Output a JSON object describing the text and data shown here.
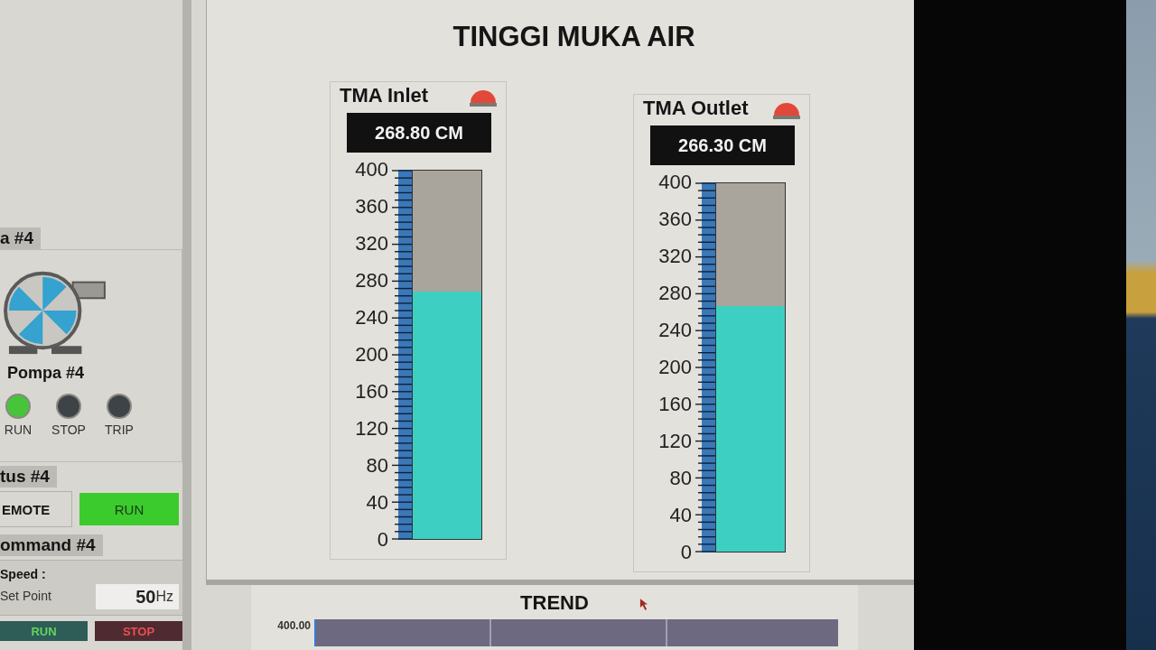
{
  "left_panel": {
    "pump": {
      "heading": "a #4",
      "name": "Pompa #4",
      "lamps": [
        {
          "label": "RUN",
          "on": true
        },
        {
          "label": "STOP",
          "on": false
        },
        {
          "label": "TRIP",
          "on": false
        }
      ]
    },
    "status": {
      "heading": "tus #4",
      "mode": "EMOTE",
      "state": {
        "label": "RUN",
        "on": true
      }
    },
    "command": {
      "heading": "ommand #4",
      "speed_label": "Speed :",
      "setpoint_label": "Set Point",
      "setpoint": {
        "value": "50",
        "unit": "Hz"
      },
      "buttons": [
        {
          "label": "RUN",
          "kind": "run"
        },
        {
          "label": "STOP",
          "kind": "stop"
        }
      ]
    }
  },
  "main_panel": {
    "title": "TINGGI MUKA AIR",
    "gauges": [
      {
        "label": "TMA Inlet",
        "alarm": true,
        "reading": "268.80 CM",
        "level": 0.672,
        "scale": [
          "400",
          "360",
          "320",
          "280",
          "240",
          "200",
          "160",
          "120",
          "80",
          "40",
          "0"
        ]
      },
      {
        "label": "TMA Outlet",
        "alarm": true,
        "reading": "266.30 CM",
        "level": 0.666,
        "scale": [
          "400",
          "360",
          "320",
          "280",
          "240",
          "200",
          "160",
          "120",
          "80",
          "40",
          "0"
        ]
      }
    ]
  },
  "trend": {
    "title": "TREND",
    "y_axis_label": "400.00"
  }
}
